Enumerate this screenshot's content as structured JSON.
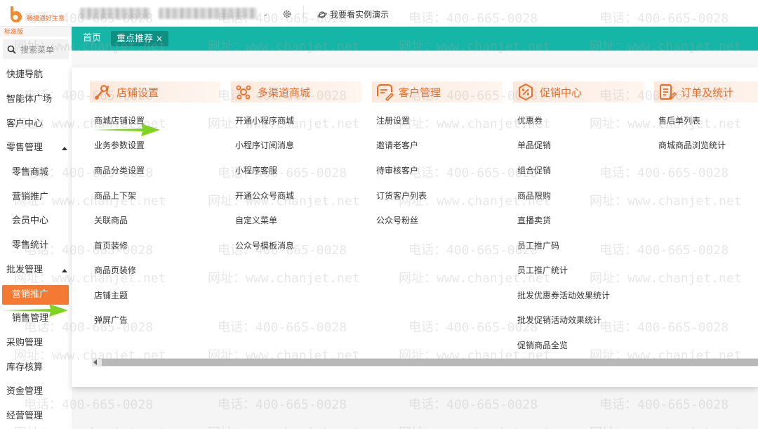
{
  "brand": {
    "name": "畅捷通好生意",
    "edition": "标准版",
    "accent": "#f06b22"
  },
  "header": {
    "demo_label": "我要看实例演示"
  },
  "sidebar": {
    "search_placeholder": "搜索菜单",
    "items": [
      {
        "label": "快捷导航"
      },
      {
        "label": "智能体广场"
      },
      {
        "label": "客户中心"
      },
      {
        "label": "零售管理",
        "expanded": true
      },
      {
        "label": "零售商城"
      },
      {
        "label": "营销推广"
      },
      {
        "label": "会员中心"
      },
      {
        "label": "零售统计"
      },
      {
        "label": "批发管理",
        "expanded": true
      },
      {
        "label": "营销推广",
        "active": true
      },
      {
        "label": "销售管理"
      },
      {
        "label": "采购管理"
      },
      {
        "label": "库存核算"
      },
      {
        "label": "资金管理"
      },
      {
        "label": "经营管理"
      }
    ]
  },
  "tabs": {
    "home": "首页",
    "current": "重点推荐",
    "close": "×",
    "bar_color": "#15b5a7"
  },
  "menu": {
    "columns": [
      {
        "title": "店铺设置",
        "icon": "tools-icon",
        "items": [
          "商城店铺设置",
          "业务参数设置",
          "商品分类设置",
          "商品上下架",
          "关联商品",
          "首页装修",
          "商品页装修",
          "店铺主题",
          "弹屏广告"
        ]
      },
      {
        "title": "多渠道商城",
        "icon": "channels-icon",
        "items": [
          "开通小程序商城",
          "小程序订阅消息",
          "小程序客服",
          "开通公众号商城",
          "自定义菜单",
          "公众号模板消息"
        ]
      },
      {
        "title": "客户管理",
        "icon": "customer-icon",
        "items": [
          "注册设置",
          "邀请老客户",
          "待审核客户",
          "订货客户列表",
          "公众号粉丝"
        ]
      },
      {
        "title": "促销中心",
        "icon": "promotion-icon",
        "items": [
          "优惠券",
          "单品促销",
          "组合促销",
          "商品限购",
          "直播卖货",
          "员工推广码",
          "员工推广统计",
          "批发优惠券活动效果统计",
          "批发促销活动效果统计",
          "促销商品全览"
        ]
      },
      {
        "title": "订单及统计",
        "icon": "order-icon",
        "items": [
          "售后单列表",
          "商城商品浏览统计"
        ]
      }
    ]
  },
  "watermark": {
    "phone": "电话：400-665-0028",
    "site": "网址：www.chanjet.net"
  }
}
